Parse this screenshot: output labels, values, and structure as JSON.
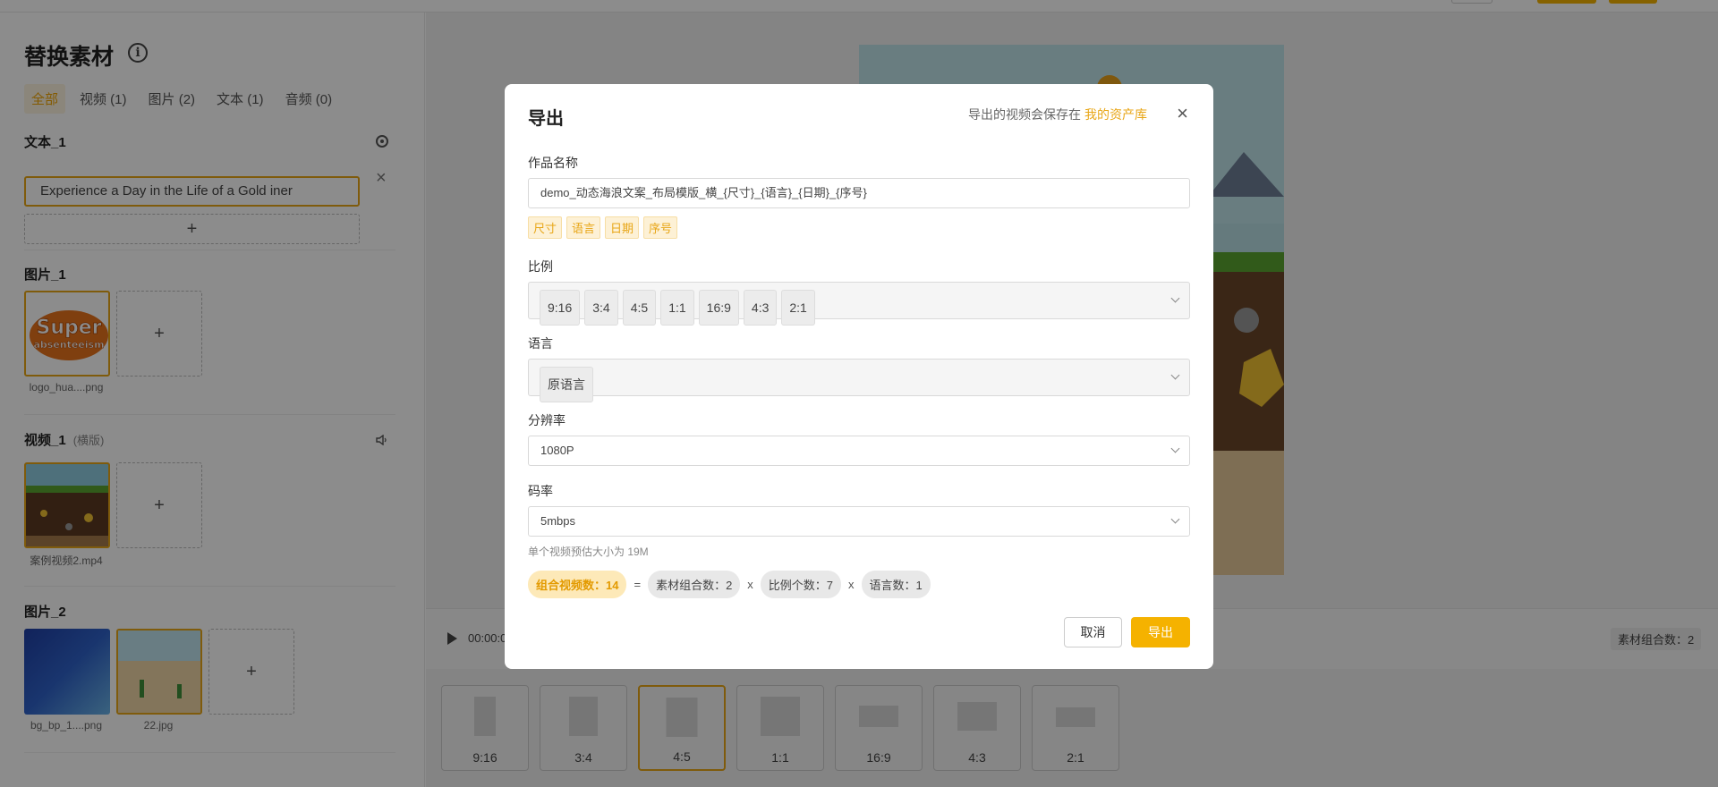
{
  "left_panel": {
    "title": "替换素材",
    "filters": [
      "全部",
      "视频 (1)",
      "图片 (2)",
      "文本 (1)",
      "音频 (0)"
    ],
    "text_section": {
      "label": "文本_1",
      "value": "Experience a Day in the Life of a Gold iner",
      "add": "+"
    },
    "image1_section": {
      "label": "图片_1",
      "captions": [
        "logo_hua....png"
      ],
      "add": "+"
    },
    "video_section": {
      "label": "视频_1",
      "sub": "(横版)",
      "captions": [
        "案例视频2.mp4"
      ],
      "add": "+"
    },
    "image2_section": {
      "label": "图片_2",
      "captions": [
        "bg_bp_1....png",
        "22.jpg"
      ],
      "add": "+"
    }
  },
  "preview": {
    "time": "00:00:0",
    "combo_badge": "素材组合数：2",
    "ratios": [
      "9:16",
      "3:4",
      "4:5",
      "1:1",
      "16:9",
      "4:3",
      "2:1"
    ],
    "selected_ratio": "4:5"
  },
  "modal": {
    "title": "导出",
    "hint": "导出的视频会保存在",
    "hint_link": "我的资产库",
    "close": "×",
    "name_label": "作品名称",
    "name_value": "demo_动态海浪文案_布局模版_横_{尺寸}_{语言}_{日期}_{序号}",
    "name_tags": [
      "尺寸",
      "语言",
      "日期",
      "序号"
    ],
    "ratio_label": "比例",
    "ratio_chips": [
      "9:16",
      "3:4",
      "4:5",
      "1:1",
      "16:9",
      "4:3",
      "2:1"
    ],
    "lang_label": "语言",
    "lang_chip": "原语言",
    "res_label": "分辨率",
    "res_value": "1080P",
    "bitrate_label": "码率",
    "bitrate_value": "5mbps",
    "size_note": "单个视频预估大小为 19M",
    "formula": {
      "total": "组合视频数：14",
      "eq": "=",
      "material": "素材组合数：2",
      "x1": "x",
      "ratio_count": "比例个数：7",
      "x2": "x",
      "lang_count": "语言数：1"
    },
    "cancel": "取消",
    "export": "导出"
  },
  "colors": {
    "accent": "#f5b200",
    "accent_text": "#e8a617"
  }
}
